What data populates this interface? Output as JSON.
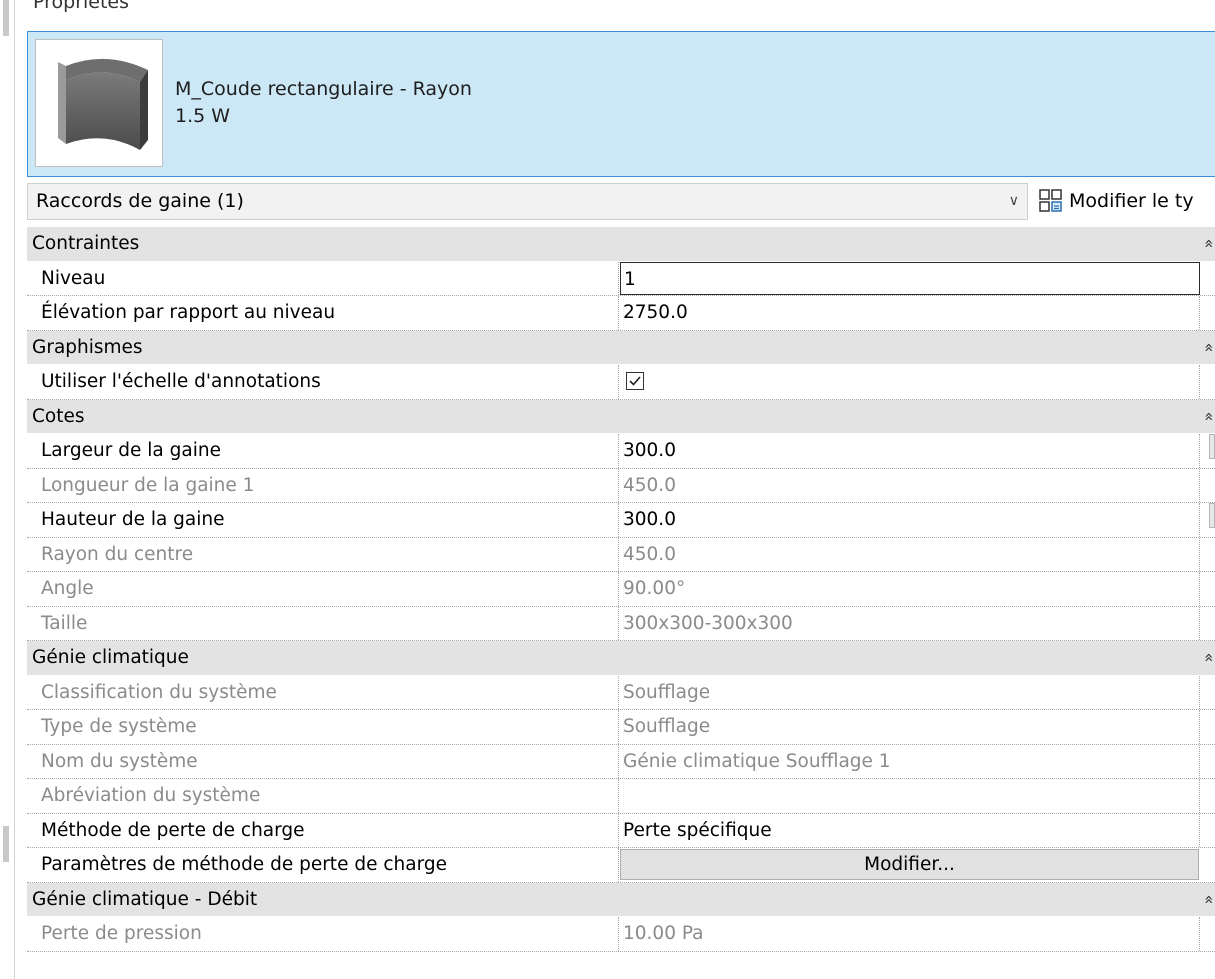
{
  "panel": {
    "title": "Propriétés"
  },
  "type_selector": {
    "family_name": "M_Coude rectangulaire - Rayon",
    "type_name": "1.5 W",
    "thumbnail_icon": "rectangular-elbow-icon"
  },
  "instance_filter": {
    "label": "Raccords de gaine (1)",
    "edit_type_label": "Modifier le ty"
  },
  "groups": [
    {
      "title": "Contraintes",
      "rows": [
        {
          "name": "Niveau",
          "value": "1",
          "readonly": false,
          "active": true
        },
        {
          "name": "Élévation par rapport au niveau",
          "value": "2750.0",
          "readonly": false
        }
      ]
    },
    {
      "title": "Graphismes",
      "rows": [
        {
          "name": "Utiliser l'échelle d'annotations",
          "checkbox": true,
          "checked": true,
          "readonly": false
        }
      ]
    },
    {
      "title": "Cotes",
      "rows": [
        {
          "name": "Largeur de la gaine",
          "value": "300.0",
          "readonly": false,
          "tab": true
        },
        {
          "name": "Longueur de la gaine 1",
          "value": "450.0",
          "readonly": true
        },
        {
          "name": "Hauteur de la gaine",
          "value": "300.0",
          "readonly": false,
          "tab": true
        },
        {
          "name": "Rayon du centre",
          "value": "450.0",
          "readonly": true
        },
        {
          "name": "Angle",
          "value": "90.00°",
          "readonly": true
        },
        {
          "name": "Taille",
          "value": "300x300-300x300",
          "readonly": true
        }
      ]
    },
    {
      "title": "Génie climatique",
      "rows": [
        {
          "name": "Classification du système",
          "value": "Soufflage",
          "readonly": true
        },
        {
          "name": "Type de système",
          "value": "Soufflage",
          "readonly": true
        },
        {
          "name": "Nom du système",
          "value": "Génie climatique Soufflage 1",
          "readonly": true
        },
        {
          "name": "Abréviation du système",
          "value": "",
          "readonly": true
        },
        {
          "name": "Méthode de perte de charge",
          "value": "Perte spécifique",
          "readonly": false
        },
        {
          "name": "Paramètres de méthode de perte de charge",
          "button": "Modifier...",
          "readonly": false
        }
      ]
    },
    {
      "title": "Génie climatique - Débit",
      "rows": [
        {
          "name": "Perte de pression",
          "value": "10.00 Pa",
          "readonly": true
        }
      ]
    }
  ]
}
